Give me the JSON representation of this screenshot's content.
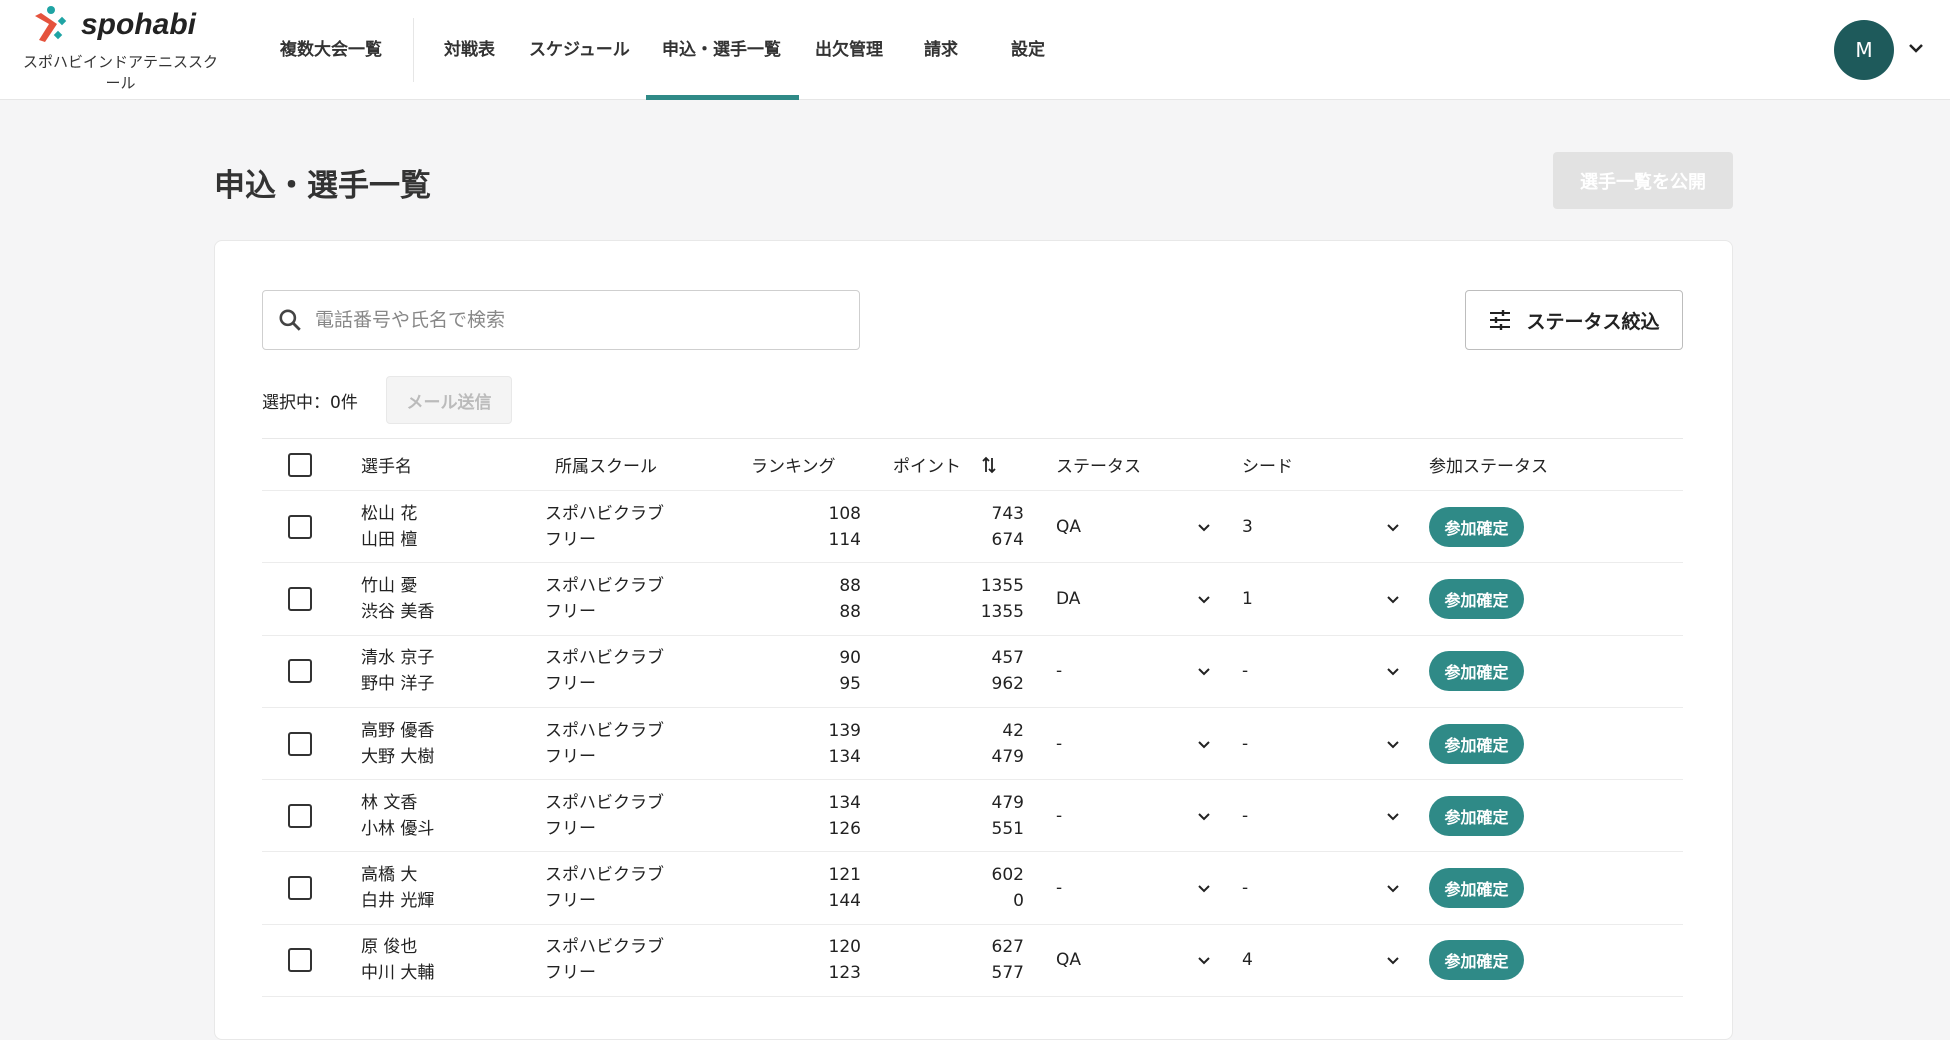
{
  "brand": {
    "logo_text": "spohabi",
    "school_name": "スポハビインドアテニススクール",
    "accent": "#2f8a87"
  },
  "nav": {
    "items": [
      "複数大会一覧",
      "対戦表",
      "スケジュール",
      "申込・選手一覧",
      "出欠管理",
      "請求",
      "設定"
    ],
    "active": "申込・選手一覧"
  },
  "user": {
    "avatar_initial": "M"
  },
  "page": {
    "title": "申込・選手一覧",
    "publish_label": "選手一覧を公開"
  },
  "search": {
    "placeholder": "電話番号や氏名で検索",
    "value": ""
  },
  "filter_label": "ステータス絞込",
  "selection": {
    "text": "選択中：0件",
    "mail_label": "メール送信"
  },
  "table": {
    "headers": [
      "選手名",
      "所属スクール",
      "ランキング",
      "ポイント",
      "ステータス",
      "シード",
      "参加ステータス"
    ],
    "rows": [
      {
        "names": [
          "松山 花",
          "山田 檀"
        ],
        "schools": [
          "スポハビクラブ",
          "フリー"
        ],
        "ranking": [
          "108",
          "114"
        ],
        "points": [
          "743",
          "674"
        ],
        "status": "QA",
        "seed": "3",
        "participation": "参加確定"
      },
      {
        "names": [
          "竹山 憂",
          "渋谷 美香"
        ],
        "schools": [
          "スポハビクラブ",
          "フリー"
        ],
        "ranking": [
          "88",
          "88"
        ],
        "points": [
          "1355",
          "1355"
        ],
        "status": "DA",
        "seed": "1",
        "participation": "参加確定"
      },
      {
        "names": [
          "清水 京子",
          "野中 洋子"
        ],
        "schools": [
          "スポハビクラブ",
          "フリー"
        ],
        "ranking": [
          "90",
          "95"
        ],
        "points": [
          "457",
          "962"
        ],
        "status": "-",
        "seed": "-",
        "participation": "参加確定"
      },
      {
        "names": [
          "高野 優香",
          "大野 大樹"
        ],
        "schools": [
          "スポハビクラブ",
          "フリー"
        ],
        "ranking": [
          "139",
          "134"
        ],
        "points": [
          "42",
          "479"
        ],
        "status": "-",
        "seed": "-",
        "participation": "参加確定"
      },
      {
        "names": [
          "林 文香",
          "小林 優斗"
        ],
        "schools": [
          "スポハビクラブ",
          "フリー"
        ],
        "ranking": [
          "134",
          "126"
        ],
        "points": [
          "479",
          "551"
        ],
        "status": "-",
        "seed": "-",
        "participation": "参加確定"
      },
      {
        "names": [
          "高橋 大",
          "白井 光輝"
        ],
        "schools": [
          "スポハビクラブ",
          "フリー"
        ],
        "ranking": [
          "121",
          "144"
        ],
        "points": [
          "602",
          "0"
        ],
        "status": "-",
        "seed": "-",
        "participation": "参加確定"
      },
      {
        "names": [
          "原 俊也",
          "中川 大輔"
        ],
        "schools": [
          "スポハビクラブ",
          "フリー"
        ],
        "ranking": [
          "120",
          "123"
        ],
        "points": [
          "627",
          "577"
        ],
        "status": "QA",
        "seed": "4",
        "participation": "参加確定"
      }
    ]
  }
}
